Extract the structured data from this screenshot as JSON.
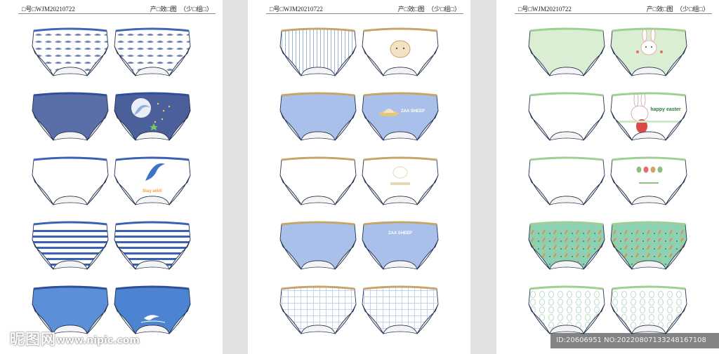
{
  "sheets": [
    {
      "code": "□号□WJM20210722",
      "title": "产□效□图　（少□组□）",
      "rows": [
        {
          "left": {
            "style": "dolphin-print",
            "base": "#ffffff",
            "accent": "#6e86b4",
            "waist": "#3e67b7"
          },
          "right": {
            "style": "dolphin-print",
            "base": "#ffffff",
            "accent": "#6e86b4",
            "waist": "#3e67b7"
          }
        },
        {
          "left": {
            "style": "solid",
            "base": "#5a6ea8",
            "accent": "#5a6ea8",
            "waist": "#2f4f9a"
          },
          "right": {
            "style": "dolphin-jump",
            "base": "#4b5f9b",
            "accent": "#ffffff",
            "waist": "#2f4f9a"
          }
        },
        {
          "left": {
            "style": "plain",
            "base": "#ffffff",
            "accent": "#ffffff",
            "waist": "#3a60b8"
          },
          "right": {
            "style": "stay-wild",
            "base": "#ffffff",
            "accent": "#3f73c8",
            "waist": "#3a60b8",
            "text": "Stay wild!"
          }
        },
        {
          "left": {
            "style": "stripes",
            "base": "#ffffff",
            "accent": "#3a62b4",
            "waist": "#3a62b4"
          },
          "right": {
            "style": "stripes",
            "base": "#ffffff",
            "accent": "#3a62b4",
            "waist": "#3a62b4"
          }
        },
        {
          "left": {
            "style": "solid",
            "base": "#5b8fd6",
            "accent": "#5b8fd6",
            "waist": "#2f4f9a"
          },
          "right": {
            "style": "small-dolphin",
            "base": "#4d84d2",
            "accent": "#ffffff",
            "waist": "#2f4f9a"
          }
        }
      ]
    },
    {
      "code": "□号□WJM20210722",
      "title": "产□效□图　（少□组□）",
      "rows": [
        {
          "left": {
            "style": "vstripes",
            "base": "#ffffff",
            "accent": "#9ab3dd",
            "waist": "#c7a467"
          },
          "right": {
            "style": "sheep-face",
            "base": "#ffffff",
            "accent": "#9ab3dd",
            "waist": "#c7a467"
          }
        },
        {
          "left": {
            "style": "solid",
            "base": "#a8c0ea",
            "accent": "#a8c0ea",
            "waist": "#c7a467"
          },
          "right": {
            "style": "ufo",
            "base": "#a8c0ea",
            "accent": "#ffffff",
            "waist": "#c7a467",
            "text": "ZAA SHEEP"
          }
        },
        {
          "left": {
            "style": "plain",
            "base": "#ffffff",
            "accent": "#ffffff",
            "waist": "#c7a467"
          },
          "right": {
            "style": "faint-sheep",
            "base": "#ffffff",
            "accent": "#e7d8b5",
            "waist": "#c7a467"
          }
        },
        {
          "left": {
            "style": "solid",
            "base": "#a8c0ea",
            "accent": "#a8c0ea",
            "waist": "#c7a467"
          },
          "right": {
            "style": "zaa-text",
            "base": "#a8c0ea",
            "accent": "#ffffff",
            "waist": "#c7a467",
            "text": "ZAA SHEEP"
          }
        },
        {
          "left": {
            "style": "grid",
            "base": "#ffffff",
            "accent": "#b6c8ea",
            "waist": "#c7a467"
          },
          "right": {
            "style": "grid",
            "base": "#ffffff",
            "accent": "#b6c8ea",
            "waist": "#c7a467"
          }
        }
      ]
    },
    {
      "code": "□号□WJM20210722",
      "title": "产□效□图　（少□组□）",
      "rows": [
        {
          "left": {
            "style": "solid",
            "base": "#d9eed2",
            "accent": "#d9eed2",
            "waist": "#9fcf93"
          },
          "right": {
            "style": "bunny",
            "base": "#d9eed2",
            "accent": "#ffffff",
            "waist": "#9fcf93"
          }
        },
        {
          "left": {
            "style": "plain",
            "base": "#ffffff",
            "accent": "#ffffff",
            "waist": "#9fcf93"
          },
          "right": {
            "style": "easter",
            "base": "#ffffff",
            "accent": "#d94b4b",
            "waist": "#9fcf93",
            "text": "happy easter"
          }
        },
        {
          "left": {
            "style": "plain",
            "base": "#ffffff",
            "accent": "#ffffff",
            "waist": "#9fcf93"
          },
          "right": {
            "style": "eggs",
            "base": "#ffffff",
            "accent": "#8cc07e",
            "waist": "#9fcf93"
          }
        },
        {
          "left": {
            "style": "carrot-print",
            "base": "#8dd0b2",
            "accent": "#e98a3c",
            "waist": "#9fcf93"
          },
          "right": {
            "style": "carrot-print",
            "base": "#8dd0b2",
            "accent": "#e98a3c",
            "waist": "#9fcf93"
          }
        },
        {
          "left": {
            "style": "egg-print",
            "base": "#ffffff",
            "accent": "#b9dcc9",
            "waist": "#9fcf93"
          },
          "right": {
            "style": "egg-print",
            "base": "#ffffff",
            "accent": "#b9dcc9",
            "waist": "#9fcf93"
          }
        }
      ]
    }
  ],
  "watermark": {
    "brand": "昵图网",
    "url": "www.nipic.com",
    "id_text": "ID:20606951 NO:20220807133248167108"
  }
}
